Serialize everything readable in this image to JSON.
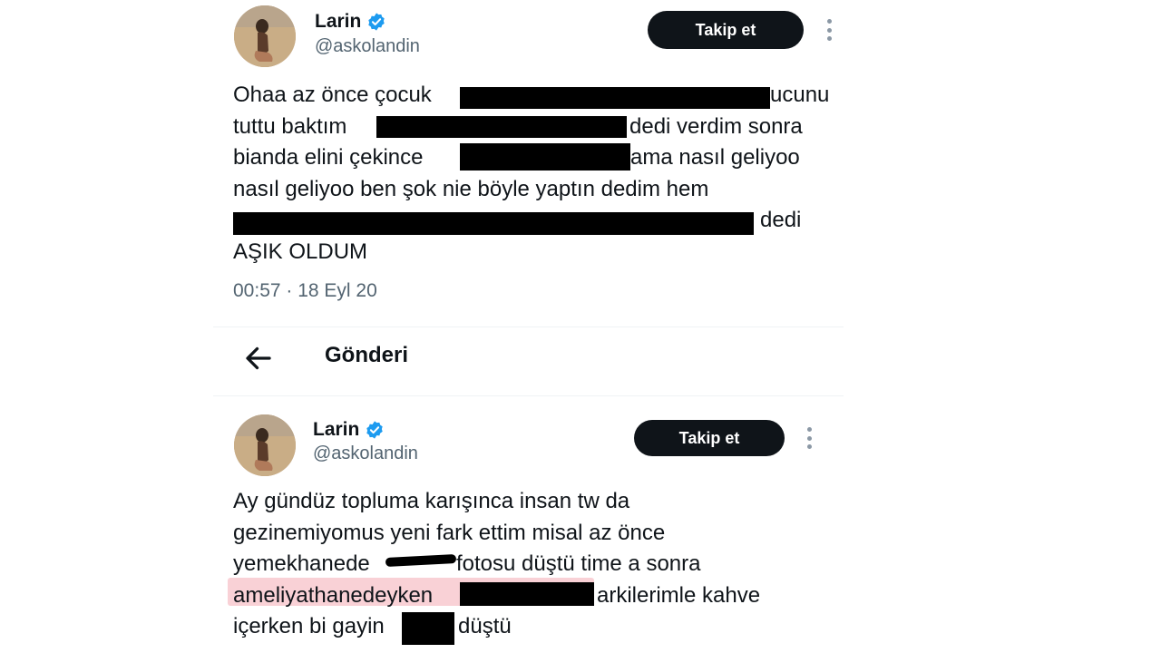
{
  "tweet_1": {
    "name": "Larin",
    "handle": "@askolandin",
    "follow_label": "Takip et",
    "lines": [
      "Ohaa az önce çocuk",
      "tuttu baktım",
      "bianda elini çekince",
      "nasıl geliyoo ben şok nie böyle yaptın dedim hem",
      "dedi",
      "AŞIK OLDUM"
    ],
    "line2_tail": "dedi verdim sonra",
    "line1_tail": "ucunu",
    "line3_tail": "ama nasıl geliyoo",
    "timestamp": "00:57 · 18 Eyl 20"
  },
  "nav": {
    "title": "Gönderi"
  },
  "tweet_2": {
    "name": "Larin",
    "handle": "@askolandin",
    "follow_label": "Takip et",
    "lines": [
      "Ay gündüz topluma karışınca insan tw da",
      "gezinemiyomus yeni fark ettim misal az önce",
      "yemekhanede",
      "ameliyathanedeyken",
      "içerken bi gayin"
    ],
    "line3_tail": "fotosu düştü time a sonra",
    "line4_tail": "arkilerimle kahve",
    "line5_tail": "düştü"
  },
  "colors": {
    "text": "#0f1419",
    "secondary": "#536471",
    "verified": "#1d9bf0",
    "button": "#0f1419",
    "highlight": "#f9d1d6"
  },
  "icons": [
    "verified-badge-icon",
    "more-options-icon",
    "back-arrow-icon"
  ]
}
